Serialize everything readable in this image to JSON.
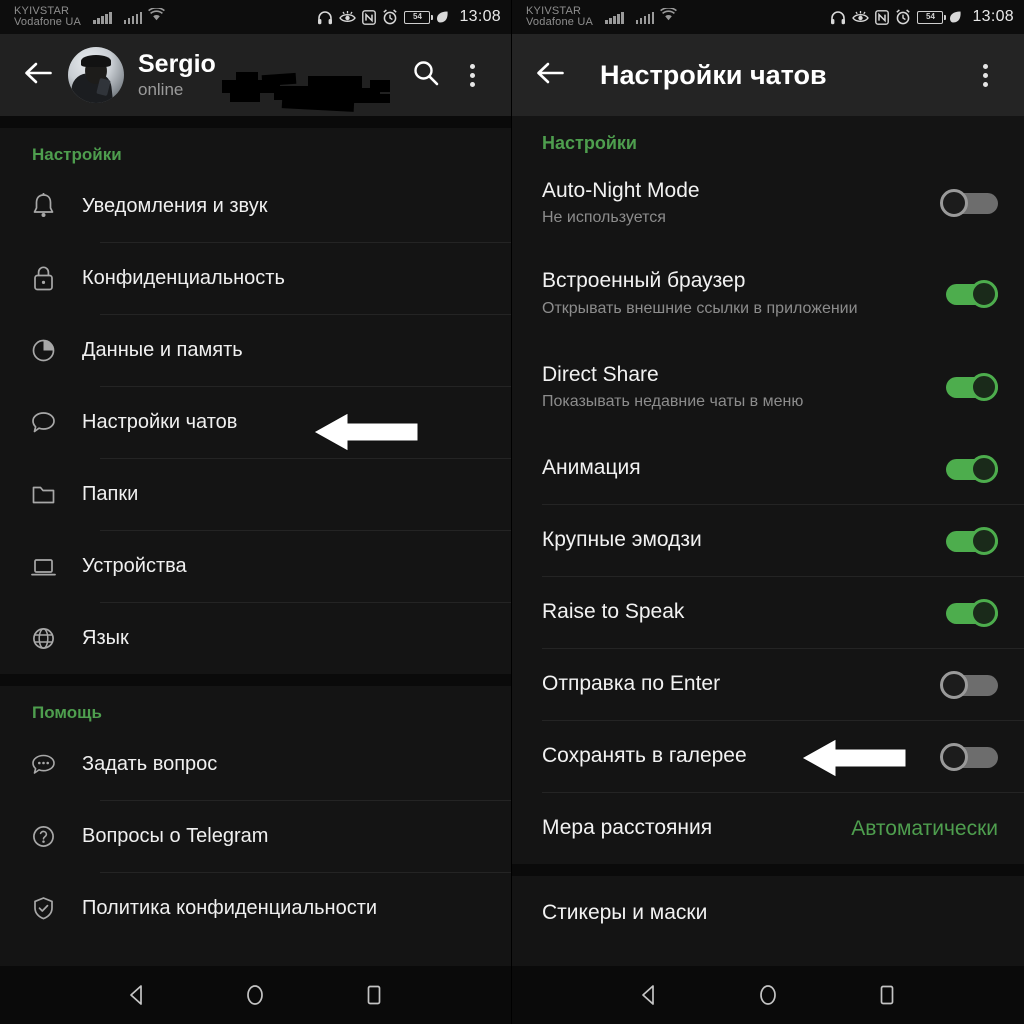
{
  "status_bar": {
    "carrier_line1": "KYIVSTAR",
    "carrier_line2": "Vodafone UA",
    "battery_percent": "54",
    "time": "13:08",
    "icons": [
      "headphones-icon",
      "eye-comfort-icon",
      "nfc-icon",
      "alarm-icon",
      "battery-icon",
      "power-save-leaf-icon"
    ]
  },
  "left": {
    "appbar": {
      "back_icon": "arrow-left-icon",
      "contact_name": "Sergio",
      "contact_status": "online",
      "search_icon": "search-icon",
      "overflow_icon": "more-vertical-icon"
    },
    "settings_section": {
      "header": "Настройки",
      "items": [
        {
          "label": "Уведомления и звук",
          "icon": "bell-icon"
        },
        {
          "label": "Конфиденциальность",
          "icon": "lock-icon"
        },
        {
          "label": "Данные и память",
          "icon": "pie-chart-icon"
        },
        {
          "label": "Настройки чатов",
          "icon": "chat-bubble-icon",
          "marked": true
        },
        {
          "label": "Папки",
          "icon": "folder-icon"
        },
        {
          "label": "Устройства",
          "icon": "laptop-icon"
        },
        {
          "label": "Язык",
          "icon": "globe-icon"
        }
      ]
    },
    "help_section": {
      "header": "Помощь",
      "items": [
        {
          "label": "Задать вопрос",
          "icon": "chat-dots-icon"
        },
        {
          "label": "Вопросы о Telegram",
          "icon": "question-circle-icon"
        },
        {
          "label": "Политика конфиденциальности",
          "icon": "shield-check-icon"
        }
      ]
    }
  },
  "right": {
    "appbar": {
      "back_icon": "arrow-left-icon",
      "title": "Настройки чатов",
      "overflow_icon": "more-vertical-icon"
    },
    "settings_section": {
      "header": "Настройки",
      "items": [
        {
          "label": "Auto-Night Mode",
          "desc": "Не используется",
          "control": "toggle",
          "state": "off"
        },
        {
          "label": "Встроенный браузер",
          "desc": "Открывать внешние ссылки в приложении",
          "control": "toggle",
          "state": "on"
        },
        {
          "label": "Direct Share",
          "desc": "Показывать недавние чаты в меню",
          "control": "toggle",
          "state": "on"
        },
        {
          "label": "Анимация",
          "desc": "",
          "control": "toggle",
          "state": "on"
        },
        {
          "label": "Крупные эмодзи",
          "desc": "",
          "control": "toggle",
          "state": "on"
        },
        {
          "label": "Raise to Speak",
          "desc": "",
          "control": "toggle",
          "state": "on"
        },
        {
          "label": "Отправка по Enter",
          "desc": "",
          "control": "toggle",
          "state": "off"
        },
        {
          "label": "Сохранять в галерее",
          "desc": "",
          "control": "toggle",
          "state": "off",
          "marked": true
        },
        {
          "label": "Мера расстояния",
          "desc": "",
          "control": "value",
          "value": "Автоматически"
        }
      ]
    },
    "stickers_section": {
      "items": [
        {
          "label": "Стикеры и маски"
        }
      ]
    }
  },
  "nav_bar": {
    "back": "nav-back-icon",
    "home": "nav-home-icon",
    "recents": "nav-recents-icon"
  },
  "colors": {
    "accent_green": "#4e9e4e",
    "toggle_on": "#4dad4d",
    "toggle_off": "#6d6d6d",
    "background": "#141414",
    "appbar": "#212121"
  }
}
